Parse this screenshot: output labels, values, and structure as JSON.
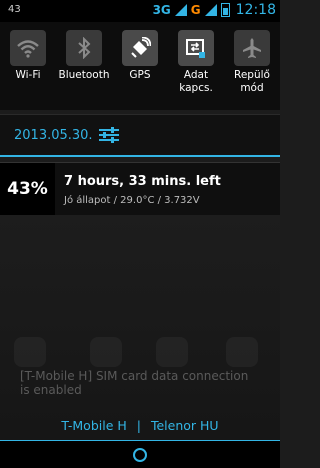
{
  "status_bar": {
    "left_text": "43",
    "network_3g": "3G",
    "network_g": "G",
    "time": "12:18",
    "accent": "#33b5e5"
  },
  "toggles": [
    {
      "label": "Wi-Fi",
      "icon": "wifi-icon",
      "state": "off"
    },
    {
      "label": "Bluetooth",
      "icon": "bluetooth-icon",
      "state": "off"
    },
    {
      "label": "GPS",
      "icon": "gps-icon",
      "state": "on"
    },
    {
      "label": "Adat kapcs.",
      "icon": "data-icon",
      "state": "on"
    },
    {
      "label": "Repülő mód",
      "icon": "airplane-icon",
      "state": "off"
    }
  ],
  "date_row": {
    "date": "2013.05.30.",
    "settings_icon": "settings-sliders-icon"
  },
  "battery_notification": {
    "percent": "43%",
    "title": "7 hours, 33 mins. left",
    "subtitle": "Jó állapot / 29.0°C / 3.732V"
  },
  "background_toast": "[T-Mobile H] SIM card data connection is enabled",
  "carriers": {
    "carrier1": "T-Mobile H",
    "separator": "|",
    "carrier2": "Telenor HU"
  }
}
